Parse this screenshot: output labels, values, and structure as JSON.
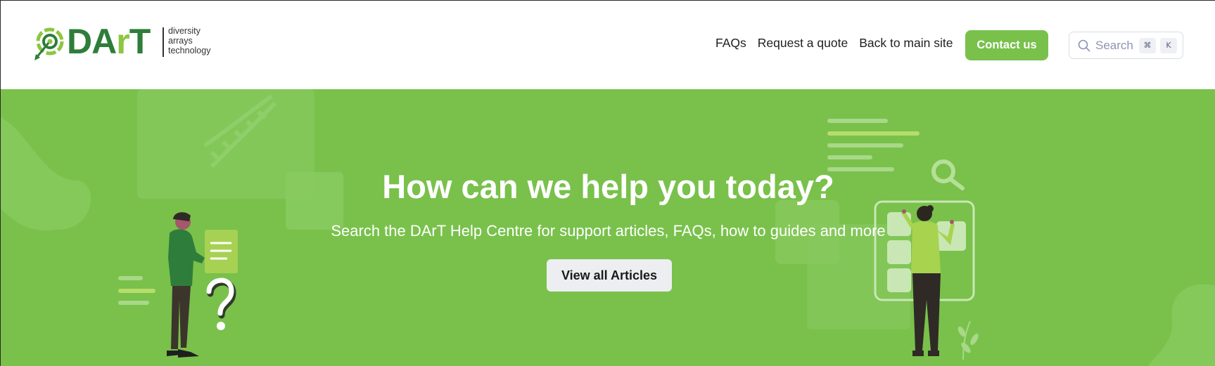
{
  "brand": {
    "wordmark_main": "DA",
    "wordmark_accent": "r",
    "wordmark_end": "T",
    "tagline": [
      "diversity",
      "arrays",
      "technology"
    ],
    "logo_icon": "target-arrow-icon",
    "colors": {
      "dark_green": "#2e7d3a",
      "light_green": "#8dc63f"
    }
  },
  "nav": {
    "links": [
      "FAQs",
      "Request a quote",
      "Back to main site"
    ]
  },
  "contact_button": {
    "label": "Contact us",
    "color": "#79c14b"
  },
  "search": {
    "placeholder": "Search",
    "shortcut_keys": [
      "⌘",
      "K"
    ],
    "icon": "search-icon"
  },
  "hero": {
    "background": "#79c14b",
    "title": "How can we help you today?",
    "subtitle": "Search the DArT Help Centre for support articles, FAQs, how to guides and more",
    "button_label": "View all Articles",
    "illustrations": [
      "dna-icon",
      "magnifier-icon",
      "question-mark-icon",
      "document-icon",
      "person-with-document",
      "person-at-board"
    ]
  }
}
